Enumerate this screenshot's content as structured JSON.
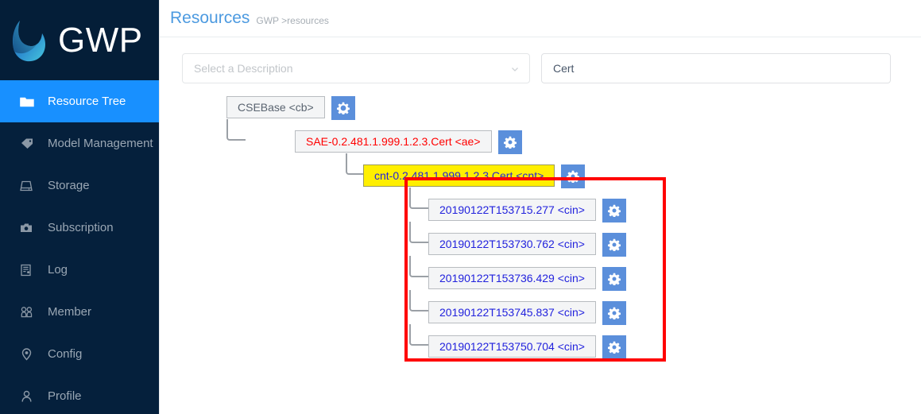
{
  "brand": {
    "name": "GWP",
    "logo_icon": "crescent-flame-logo"
  },
  "sidebar": {
    "items": [
      {
        "label": "Resource Tree",
        "icon": "folder-icon",
        "active": true
      },
      {
        "label": "Model Management",
        "icon": "tag-icon",
        "active": false
      },
      {
        "label": "Storage",
        "icon": "hard-drive-icon",
        "active": false
      },
      {
        "label": "Subscription",
        "icon": "camera-icon",
        "active": false
      },
      {
        "label": "Log",
        "icon": "log-icon",
        "active": false
      },
      {
        "label": "Member",
        "icon": "members-icon",
        "active": false
      },
      {
        "label": "Config",
        "icon": "location-pin-icon",
        "active": false
      },
      {
        "label": "Profile",
        "icon": "user-icon",
        "active": false
      }
    ]
  },
  "header": {
    "title": "Resources",
    "breadcrumb": "GWP >resources"
  },
  "filters": {
    "description_select": {
      "placeholder": "Select a Description",
      "value": "",
      "caret_icon": "chevron-down-icon"
    },
    "search_input": {
      "value": "Cert",
      "placeholder": ""
    }
  },
  "tree": {
    "gear_icon": "gear-icon",
    "nodes": [
      {
        "label": "CSEBase <cb>",
        "style": "plain",
        "indent": 0
      },
      {
        "label": "SAE-0.2.481.1.999.1.2.3.Cert <ae>",
        "style": "red",
        "indent": 1
      },
      {
        "label": "cnt-0.2.481.1.999.1.2.3.Cert <cnt>",
        "style": "yellow",
        "indent": 2
      },
      {
        "label": "20190122T153715.277 <cin>",
        "style": "blue",
        "indent": 3
      },
      {
        "label": "20190122T153730.762 <cin>",
        "style": "blue",
        "indent": 3
      },
      {
        "label": "20190122T153736.429 <cin>",
        "style": "blue",
        "indent": 3
      },
      {
        "label": "20190122T153745.837 <cin>",
        "style": "blue",
        "indent": 3
      },
      {
        "label": "20190122T153750.704 <cin>",
        "style": "blue",
        "indent": 3
      }
    ]
  },
  "colors": {
    "sidebar_bg": "#05203c",
    "accent_blue": "#1890ff",
    "title_blue": "#4c9ae0",
    "gear_blue": "#5b8fdb",
    "highlight_yellow": "#ffef00",
    "highlight_red": "#ff0000",
    "node_text_blue": "#2222dd"
  }
}
